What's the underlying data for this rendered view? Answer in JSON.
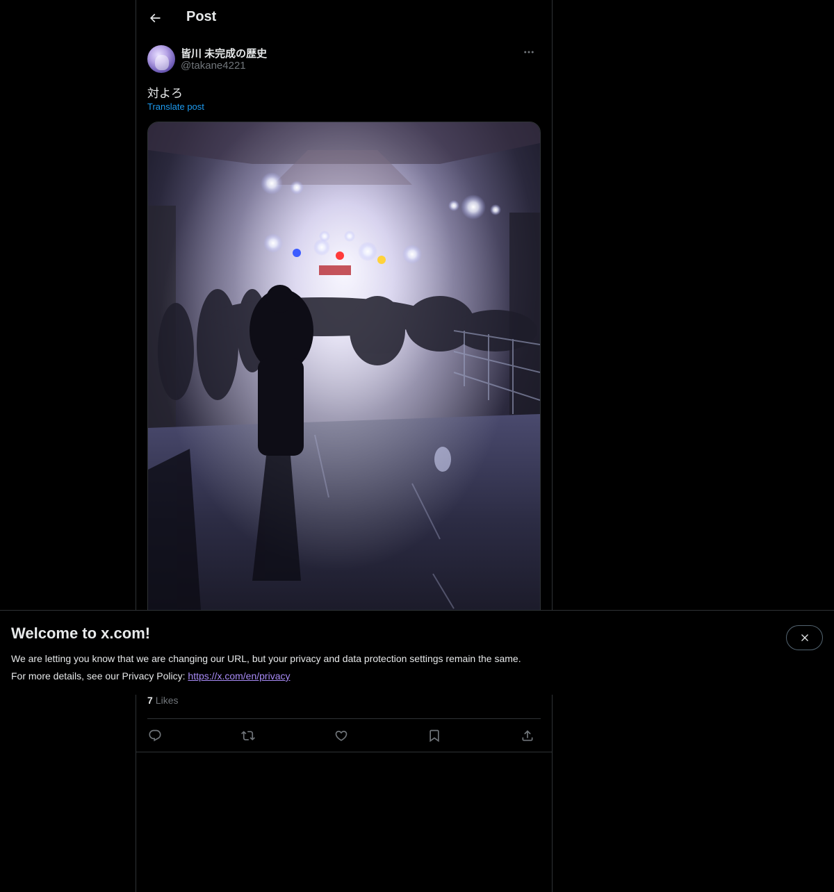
{
  "header": {
    "title": "Post",
    "back_icon": "arrow-left-icon"
  },
  "post": {
    "author": {
      "display_name": "皆川 未完成の歴史",
      "handle": "@takane4221"
    },
    "text": "対よろ",
    "translate_label": "Translate post",
    "media": {
      "type": "photo",
      "description_icon": "concert-photo"
    },
    "likes": {
      "count": "7",
      "label": "Likes"
    },
    "actions": {
      "reply_icon": "reply-icon",
      "repost_icon": "repost-icon",
      "like_icon": "heart-icon",
      "bookmark_icon": "bookmark-icon",
      "share_icon": "share-icon"
    }
  },
  "banner": {
    "title": "Welcome to x.com!",
    "line1": "We are letting you know that we are changing our URL, but your privacy and data protection settings remain the same.",
    "line2_prefix": "For more details, see our Privacy Policy: ",
    "link_text": "https://x.com/en/privacy",
    "close_icon": "close-icon"
  },
  "colors": {
    "background": "#000000",
    "text": "#e7e9ea",
    "muted": "#71767b",
    "accent": "#1d9bf0",
    "link": "#a98cf8",
    "border": "#2f3336"
  }
}
